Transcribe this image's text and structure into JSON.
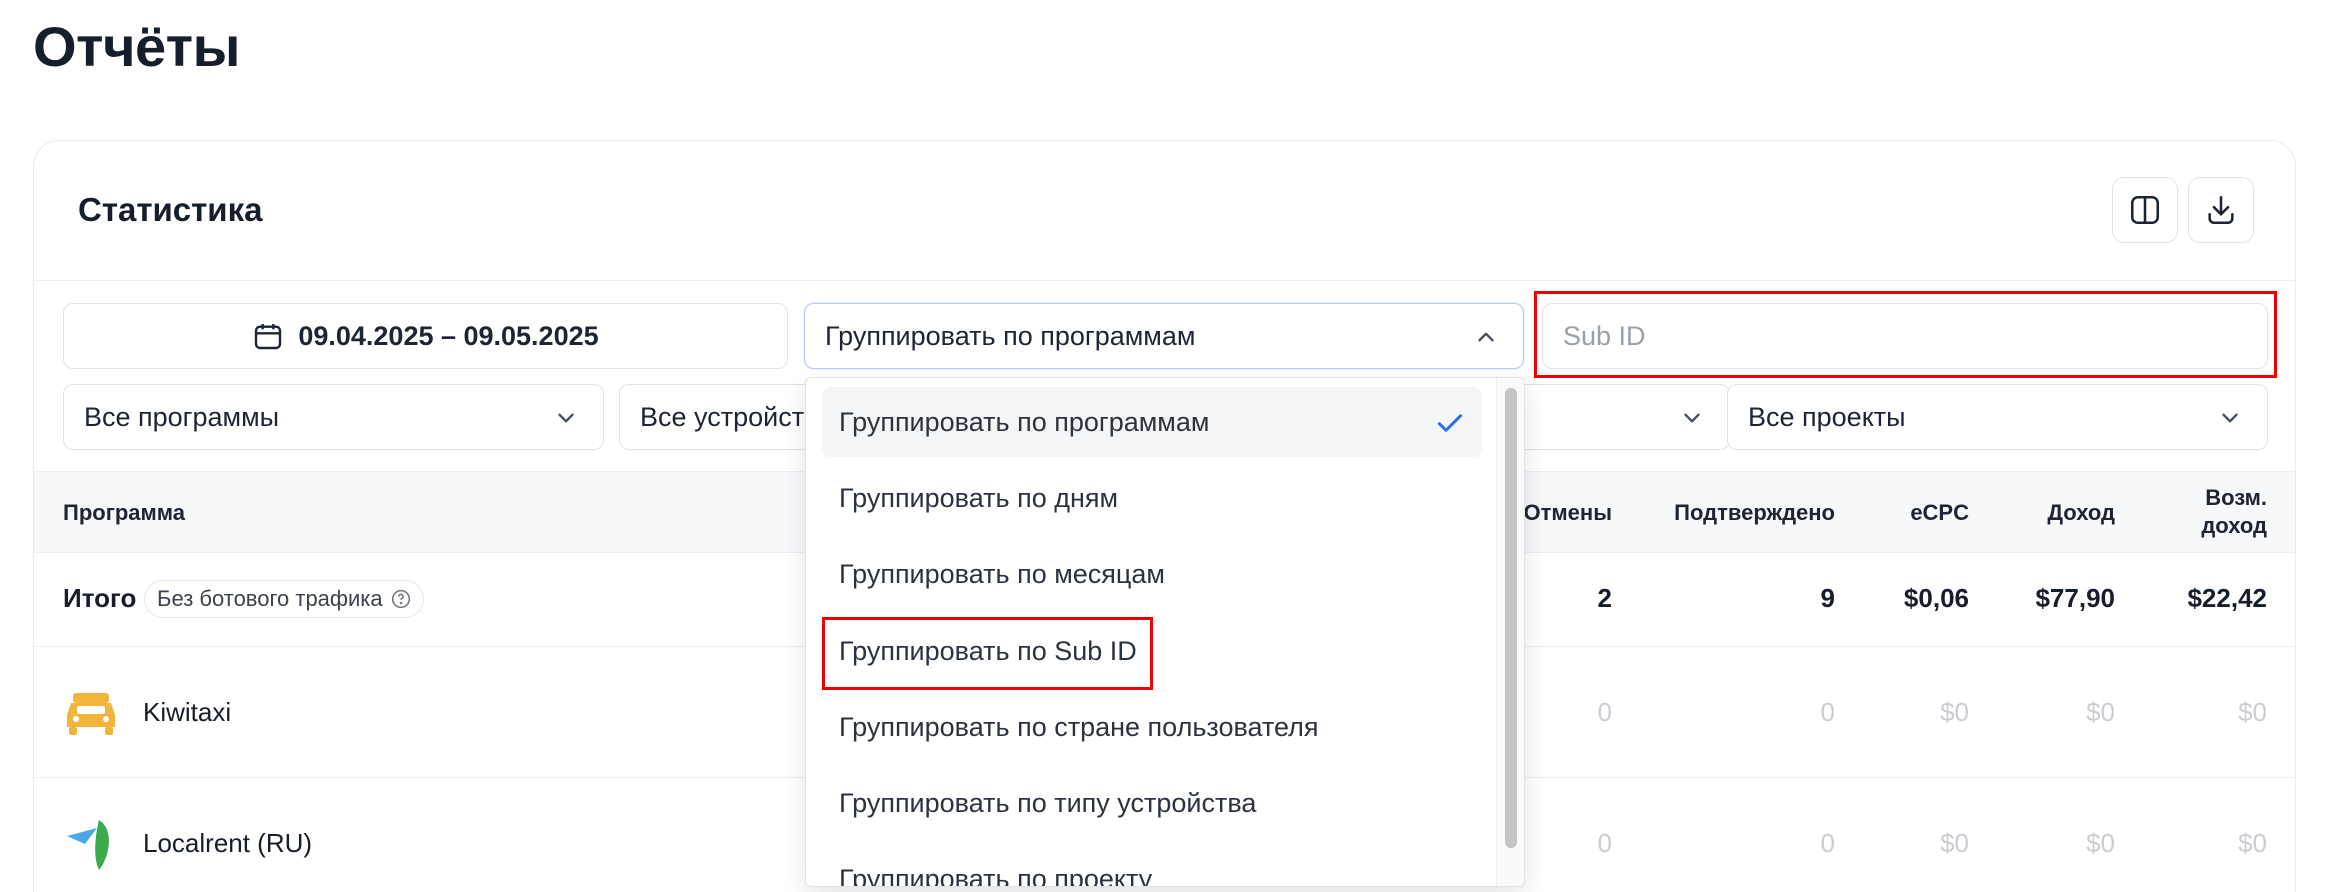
{
  "page": {
    "title": "Отчёты"
  },
  "card": {
    "title": "Статистика"
  },
  "toolbar": {
    "columns_icon": "columns-icon",
    "download_icon": "download-icon"
  },
  "filters": {
    "date_range": "09.04.2025 – 09.05.2025",
    "group_by": "Группировать по программам",
    "subid_placeholder": "Sub ID",
    "programs": "Все программы",
    "devices": "Все устройст",
    "projects": "Все проекты"
  },
  "dropdown": {
    "options": [
      "Группировать по программам",
      "Группировать по дням",
      "Группировать по месяцам",
      "Группировать по Sub ID",
      "Группировать по стране пользователя",
      "Группировать по типу устройства",
      "Группировать по проекту"
    ],
    "selected": "Группировать по программам"
  },
  "table": {
    "headers": {
      "program": "Программа",
      "cancelled": "Отмены",
      "confirmed": "Подтверждено",
      "ecpc": "eCPC",
      "income": "Доход",
      "possible_income_1": "Возм.",
      "possible_income_2": "доход"
    },
    "total": {
      "label": "Итого",
      "badge": "Без ботового трафика",
      "cancelled": "2",
      "confirmed": "9",
      "ecpc": "$0,06",
      "income": "$77,90",
      "possible_income": "$22,42"
    },
    "rows": [
      {
        "name": "Kiwitaxi",
        "cancelled": "0",
        "confirmed": "0",
        "ecpc": "$0",
        "income": "$0",
        "possible_income": "$0"
      },
      {
        "name": "Localrent (RU)",
        "cancelled": "0",
        "confirmed": "0",
        "ecpc": "$0",
        "income": "$0",
        "possible_income": "$0"
      }
    ]
  },
  "colors": {
    "accent": "#2f6fe4",
    "highlight": "#ee0000",
    "taxi": "#f3b43c"
  }
}
